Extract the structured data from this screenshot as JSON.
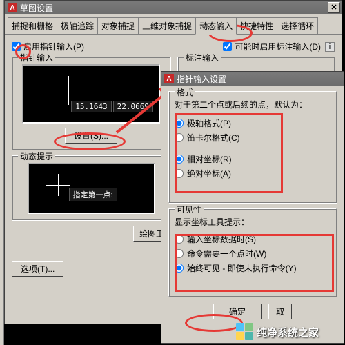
{
  "mainWindow": {
    "title": "草图设置",
    "tabs": [
      "捕捉和栅格",
      "极轴追踪",
      "对象捕捉",
      "三维对象捕捉",
      "动态输入",
      "快捷特性",
      "选择循环"
    ],
    "activeTabIndex": 4,
    "enablePointerInput": "启用指针输入(P)",
    "enableDimInput": "可能时启用标注输入(D)",
    "pointerInputLegend": "指针输入",
    "dimInputLegend": "标注输入",
    "coords": {
      "x": "15.1643",
      "y": "22.0669"
    },
    "settingsButton": "设置(S)...",
    "dynPromptLegend": "动态提示",
    "dynPromptText": "指定第一点:",
    "drawButton": "绘图工",
    "optionsButton": "选项(T)..."
  },
  "subWindow": {
    "title": "指针输入设置",
    "formatLegend": "格式",
    "formatCaption": "对于第二个点或后续的点，默认为：",
    "radios": {
      "polar": "极轴格式(P)",
      "cartesian": "笛卡尔格式(C)",
      "relative": "相对坐标(R)",
      "absolute": "绝对坐标(A)"
    },
    "visLegend": "可见性",
    "visCaption": "显示坐标工具提示：",
    "visRadios": {
      "onData": "输入坐标数据时(S)",
      "onNeed": "命令需要一个点时(W)",
      "always": "始终可见 - 即使未执行命令(Y)"
    },
    "okButton": "确定",
    "cancelButton": "取"
  },
  "watermark": "纯净系统之家"
}
